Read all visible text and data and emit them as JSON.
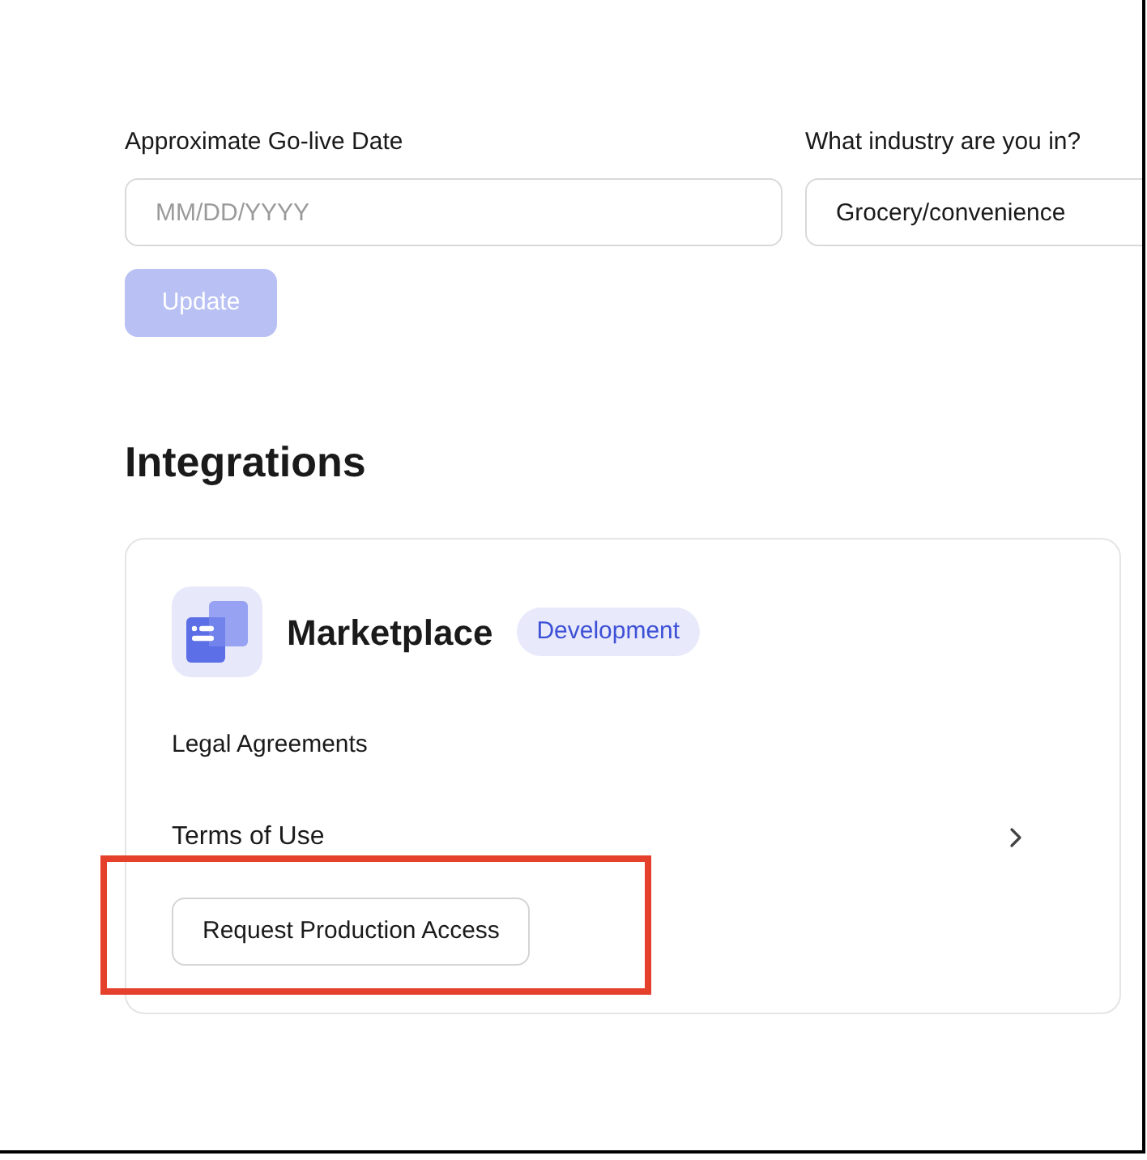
{
  "date_field": {
    "label": "Approximate Go-live Date",
    "placeholder": "MM/DD/YYYY"
  },
  "industry_field": {
    "label": "What industry are you in?",
    "value": "Grocery/convenience"
  },
  "update_button": {
    "label": "Update",
    "disabled": true
  },
  "integrations": {
    "title": "Integrations",
    "cards": [
      {
        "name": "Marketplace",
        "badge": "Development",
        "section_title": "Legal Agreements",
        "links": [
          {
            "label": "Terms of Use"
          }
        ],
        "action_button": "Request Production Access"
      }
    ]
  }
}
